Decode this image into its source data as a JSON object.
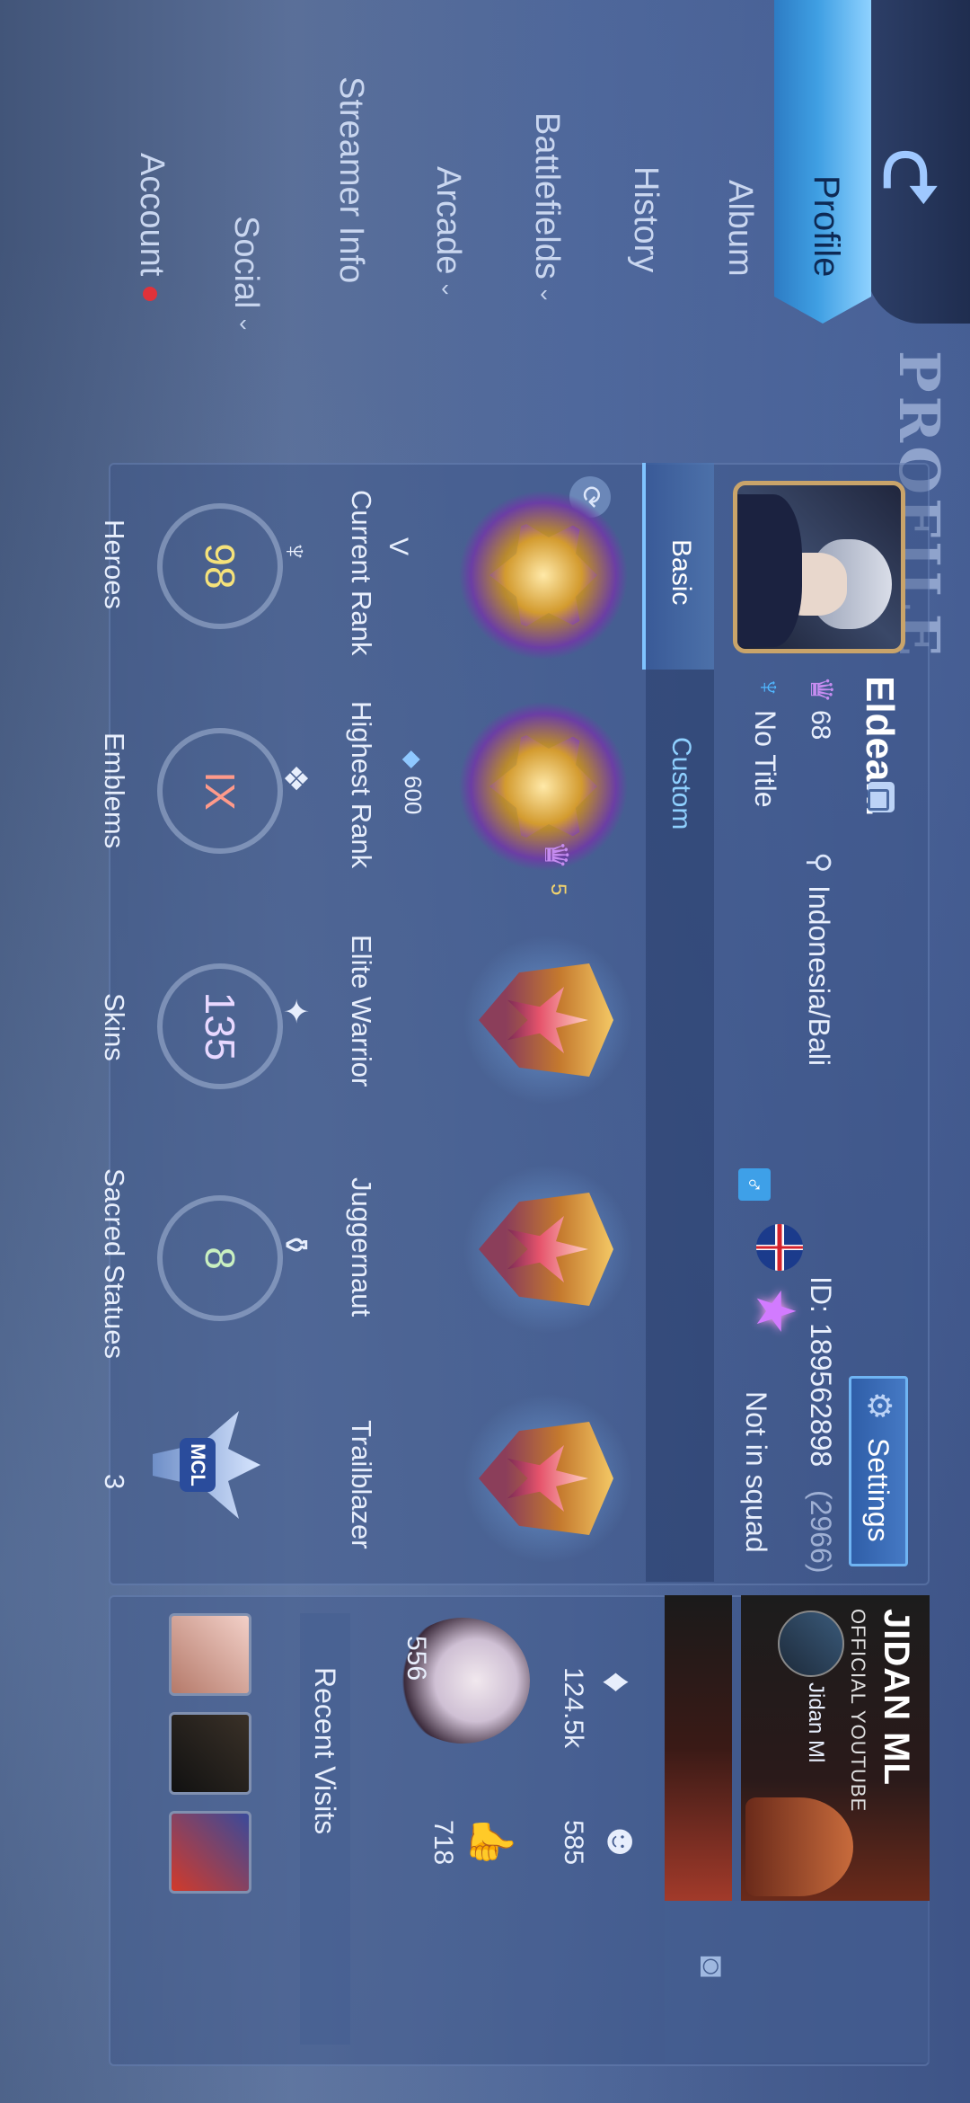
{
  "page": {
    "title": "PROFILE"
  },
  "nav": {
    "items": [
      {
        "label": "Profile",
        "active": true
      },
      {
        "label": "Album"
      },
      {
        "label": "History"
      },
      {
        "label": "Battlefields",
        "chevron": true
      },
      {
        "label": "Arcade",
        "chevron": true
      },
      {
        "label": "Streamer Info"
      },
      {
        "label": "Social",
        "chevron": true
      },
      {
        "label": "Account",
        "notification": true
      }
    ]
  },
  "player": {
    "name": "Eldean.",
    "level": "68",
    "location": "Indonesia/Bali",
    "title": "No Title",
    "id_label": "ID:",
    "id_value": "189562898",
    "id_extra": "(2966)",
    "squad": "Not in squad",
    "settings_label": "Settings"
  },
  "tabs": [
    {
      "label": "Basic",
      "active": true
    },
    {
      "label": "Custom"
    }
  ],
  "ranks": {
    "current_label": "Current Rank",
    "current_tier": "V",
    "highest_label": "Highest Rank",
    "highest_points": "600",
    "highest_stars": "5"
  },
  "achievements": [
    {
      "label": "Elite Warrior"
    },
    {
      "label": "Juggernaut"
    },
    {
      "label": "Trailblazer"
    }
  ],
  "stats": [
    {
      "label": "Heroes",
      "value": "98",
      "color": "#f5e27a"
    },
    {
      "label": "Emblems",
      "value": "IX",
      "color": "#ff9a8a"
    },
    {
      "label": "Skins",
      "value": "135",
      "color": "#e8d8ff"
    },
    {
      "label": "Sacred Statues",
      "value": "8",
      "color": "#c9f0c0"
    },
    {
      "label": "MCL",
      "value": "3",
      "color": "#ffffff"
    }
  ],
  "social": {
    "banner_title": "JIDAN ML",
    "banner_subtitle": "OFFICIAL YOUTUBE",
    "channel_name": "Jidan Ml",
    "likes": "124.5k",
    "followers": "585",
    "pet_count": "556",
    "thumbs": "718",
    "recent_visits_label": "Recent Visits"
  },
  "icons": {
    "back": "back-arrow-icon",
    "copy": "copy-icon",
    "location": "location-pin-icon",
    "gear": "gear-icon",
    "refresh": "refresh-icon",
    "camera": "camera-icon"
  },
  "colors": {
    "accent": "#3f9fe3",
    "background": "#4c6496",
    "gold": "#c9a46a"
  }
}
